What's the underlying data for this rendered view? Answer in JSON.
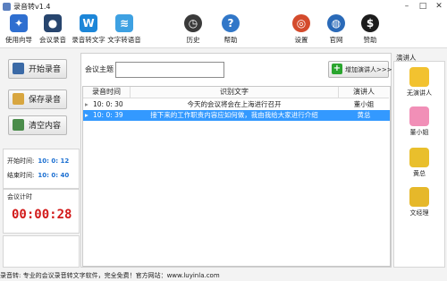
{
  "window": {
    "title": "录音转v1.4"
  },
  "toolbar": {
    "items": [
      {
        "label": "使用向导",
        "icon": "blue-wand-icon",
        "color": "#2f6fd0"
      },
      {
        "label": "会议录音",
        "icon": "microphone-icon",
        "color": "#27456e"
      },
      {
        "label": "录音转文字",
        "icon": "word-doc-icon",
        "color": "#1d86d8"
      },
      {
        "label": "文字转语音",
        "icon": "speech-doc-icon",
        "color": "#3ea1e2"
      },
      {
        "label": "历史",
        "icon": "history-clock-icon",
        "color": "#3a3a3a"
      },
      {
        "label": "帮助",
        "icon": "help-question-icon",
        "color": "#3177c8"
      },
      {
        "label": "设置",
        "icon": "settings-lifebuoy-icon",
        "color": "#d44b2c"
      },
      {
        "label": "官网",
        "icon": "globe-icon",
        "color": "#2a6ab8"
      },
      {
        "label": "赞助",
        "icon": "money-bag-icon",
        "color": "#1c1c1c"
      }
    ]
  },
  "left": {
    "start_label": "开始录音",
    "save_label": "保存录音",
    "clear_label": "清空内容",
    "start_time_label": "开始时间:",
    "start_time_value": "10: 0: 12",
    "end_time_label": "结束时间:",
    "end_time_value": "10: 0: 40",
    "duration_label": "会议计时",
    "duration_value": "00:00:28"
  },
  "main": {
    "topic_label": "会议主题",
    "topic_value": "",
    "add_speaker_label": "增加演讲人>>>"
  },
  "table": {
    "headers": [
      "录音时间",
      "识别文字",
      "演讲人"
    ],
    "rows": [
      {
        "time": "10: 0: 30",
        "text": "今天的会议将会在上海进行召开",
        "speaker": "董小姐"
      },
      {
        "time": "10: 0: 39",
        "text": "接下来的工作职责内容应如何做，我由我给大家进行介绍",
        "speaker": "黄总"
      }
    ]
  },
  "speakers": {
    "header": "演讲人",
    "list": [
      {
        "name": "无演讲人",
        "color": "#f2c230"
      },
      {
        "name": "董小姐",
        "color": "#f18fb7"
      },
      {
        "name": "黄总",
        "color": "#e9bf2c"
      },
      {
        "name": "文经理",
        "color": "#e6b82a"
      }
    ]
  },
  "status": {
    "text": "录音转: 专业的会议录音转文字软件，完全免费！官方网站：www.luyinla.com"
  }
}
